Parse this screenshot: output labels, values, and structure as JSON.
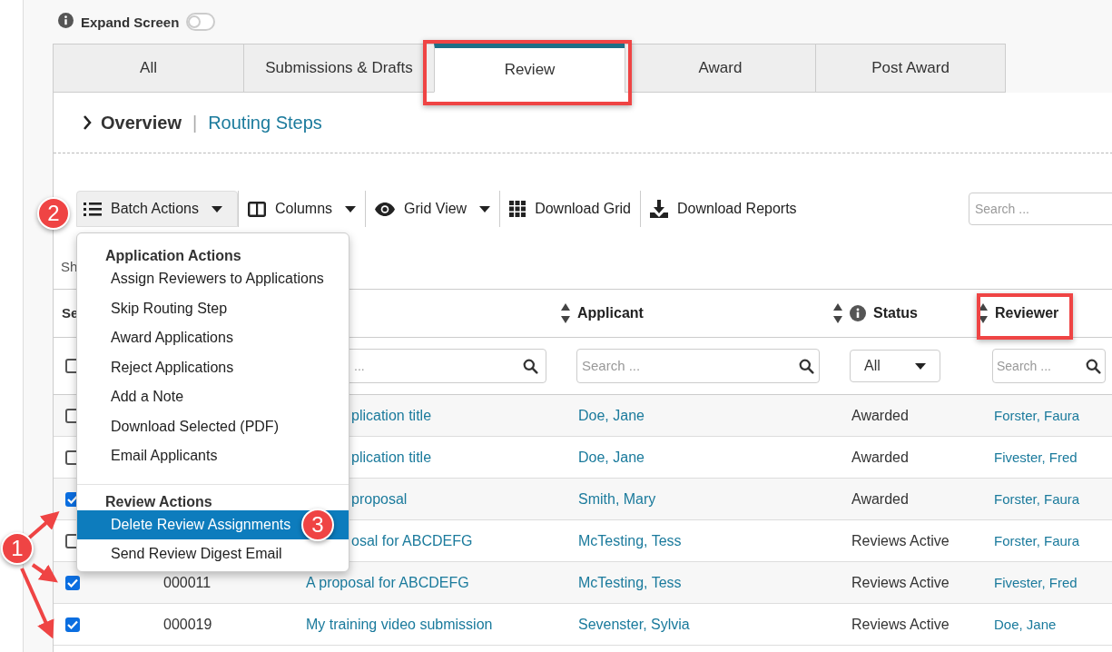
{
  "expand_screen": {
    "label": "Expand Screen",
    "on": false
  },
  "tabs": [
    {
      "label": "All",
      "selected": false
    },
    {
      "label": "Submissions & Drafts",
      "selected": false
    },
    {
      "label": "Review",
      "selected": true
    },
    {
      "label": "Award",
      "selected": false
    },
    {
      "label": "Post Award",
      "selected": false
    }
  ],
  "breadcrumb": {
    "current": "Overview",
    "separator": "|",
    "link": "Routing Steps"
  },
  "toolbar": {
    "buttons": [
      {
        "label": "Batch Actions",
        "kind": "list",
        "dropdown": true,
        "selected": true
      },
      {
        "label": "Columns",
        "kind": "columns",
        "dropdown": true,
        "selected": false
      },
      {
        "label": "Grid View",
        "kind": "eye",
        "dropdown": true,
        "selected": false
      },
      {
        "label": "Download Grid",
        "kind": "grid",
        "dropdown": false,
        "selected": false
      },
      {
        "label": "Download Reports",
        "kind": "download",
        "dropdown": false,
        "selected": false
      }
    ],
    "search": {
      "placeholder": "Search ..."
    }
  },
  "shown_text": "Sh",
  "batch_menu": {
    "sections": [
      {
        "title": "Application Actions",
        "items": [
          {
            "label": "Assign Reviewers to Applications",
            "selected": false
          },
          {
            "label": "Skip Routing Step",
            "selected": false
          },
          {
            "label": "Award Applications",
            "selected": false
          },
          {
            "label": "Reject Applications",
            "selected": false
          },
          {
            "label": "Add a Note",
            "selected": false
          },
          {
            "label": "Download Selected (PDF)",
            "selected": false
          },
          {
            "label": "Email Applicants",
            "selected": false
          }
        ]
      },
      {
        "title": "Review Actions",
        "items": [
          {
            "label": "Delete Review Assignments",
            "selected": true
          },
          {
            "label": "Send Review Digest Email",
            "selected": false
          }
        ]
      }
    ]
  },
  "table": {
    "select_header": "Se",
    "columns": [
      {
        "label": "Applicant",
        "info": false
      },
      {
        "label": "Status",
        "info": true
      },
      {
        "label": "Reviewer",
        "info": false
      }
    ],
    "filters": {
      "select_all": false,
      "title_placeholder": "...",
      "applicant_placeholder": "Search ...",
      "status_value": "All",
      "reviewer_placeholder": "Search ..."
    },
    "rows": [
      {
        "checked": false,
        "title": "plication title",
        "applicant": "Doe, Jane",
        "status": "Awarded",
        "reviewer": "Forster, Faura"
      },
      {
        "checked": false,
        "title": "plication title",
        "applicant": "Doe, Jane",
        "status": "Awarded",
        "reviewer": "Fivester, Fred"
      },
      {
        "checked": true,
        "title": "proposal",
        "applicant": "Smith, Mary",
        "status": "Awarded",
        "reviewer": "Forster, Faura"
      },
      {
        "checked": false,
        "title": "osal for ABCDEFG",
        "applicant": "McTesting, Tess",
        "status": "Reviews Active",
        "reviewer": "Forster, Faura"
      },
      {
        "checked": true,
        "id": "000011",
        "title": "A proposal for ABCDEFG",
        "applicant": "McTesting, Tess",
        "status": "Reviews Active",
        "reviewer": "Fivester, Fred"
      },
      {
        "checked": true,
        "id": "000019",
        "title": "My training video submission",
        "applicant": "Sevenster, Sylvia",
        "status": "Reviews Active",
        "reviewer": "Doe, Jane"
      }
    ]
  },
  "annotations": {
    "markers": [
      {
        "label": "1"
      },
      {
        "label": "2"
      },
      {
        "label": "3"
      }
    ]
  }
}
